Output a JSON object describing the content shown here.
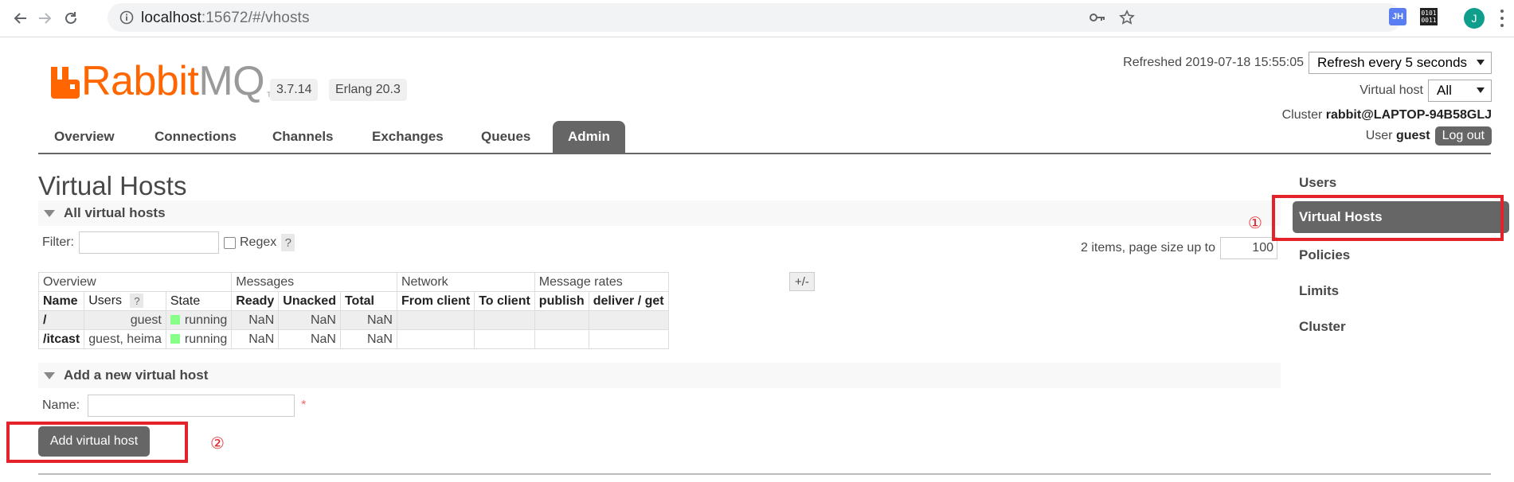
{
  "browser": {
    "url_host": "localhost",
    "url_rest": ":15672/#/vhosts",
    "ext_jh": "JH",
    "ext_bin": [
      "0101",
      "0011"
    ],
    "profile_initial": "J"
  },
  "header": {
    "logo_rabbit": "Rabbit",
    "logo_mq": "MQ",
    "logo_tm": "TM",
    "version": "3.7.14",
    "erlang": "Erlang 20.3",
    "refreshed_label": "Refreshed",
    "refreshed_time": "2019-07-18 15:55:05",
    "refresh_option": "Refresh every 5 seconds",
    "vhost_label": "Virtual host",
    "vhost_option": "All",
    "cluster_label": "Cluster",
    "cluster_name": "rabbit@LAPTOP-94B58GLJ",
    "user_label": "User",
    "user_name": "guest",
    "logout": "Log out"
  },
  "tabs": [
    "Overview",
    "Connections",
    "Channels",
    "Exchanges",
    "Queues",
    "Admin"
  ],
  "active_tab": "Admin",
  "page_title": "Virtual Hosts",
  "all_section": "All virtual hosts",
  "filter": {
    "label": "Filter:",
    "value": "",
    "regex_label": "Regex",
    "help": "?"
  },
  "paging": {
    "text": "2 items, page size up to",
    "page_size": "100"
  },
  "table": {
    "groups": [
      "Overview",
      "Messages",
      "Network",
      "Message rates"
    ],
    "columns": [
      "Name",
      "Users",
      "State",
      "Ready",
      "Unacked",
      "Total",
      "From client",
      "To client",
      "publish",
      "deliver / get"
    ],
    "users_help": "?",
    "rows": [
      {
        "name": "/",
        "users": "guest",
        "state": "running",
        "ready": "NaN",
        "unacked": "NaN",
        "total": "NaN"
      },
      {
        "name": "/itcast",
        "users": "guest, heima",
        "state": "running",
        "ready": "NaN",
        "unacked": "NaN",
        "total": "NaN"
      }
    ],
    "toggle": "+/-"
  },
  "add_section": "Add a new virtual host",
  "add_form": {
    "name_label": "Name:",
    "name_value": "",
    "required_mark": "*",
    "button": "Add virtual host"
  },
  "right_nav": [
    "Users",
    "Virtual Hosts",
    "Policies",
    "Limits",
    "Cluster"
  ],
  "right_nav_active": "Virtual Hosts",
  "annotations": {
    "marker_1": "①",
    "marker_2": "②",
    "color": "#e4222a"
  },
  "colors": {
    "brand_orange": "#ff6600",
    "tab_active_bg": "#666666",
    "running_green": "#88ff88"
  },
  "icons": [
    "back-arrow-icon",
    "forward-arrow-icon",
    "reload-icon",
    "info-icon",
    "key-icon",
    "star-icon",
    "extension-jh-icon",
    "extension-binary-icon",
    "profile-avatar",
    "menu-kebab-icon",
    "dropdown-arrow-icon",
    "collapse-triangle-icon"
  ]
}
